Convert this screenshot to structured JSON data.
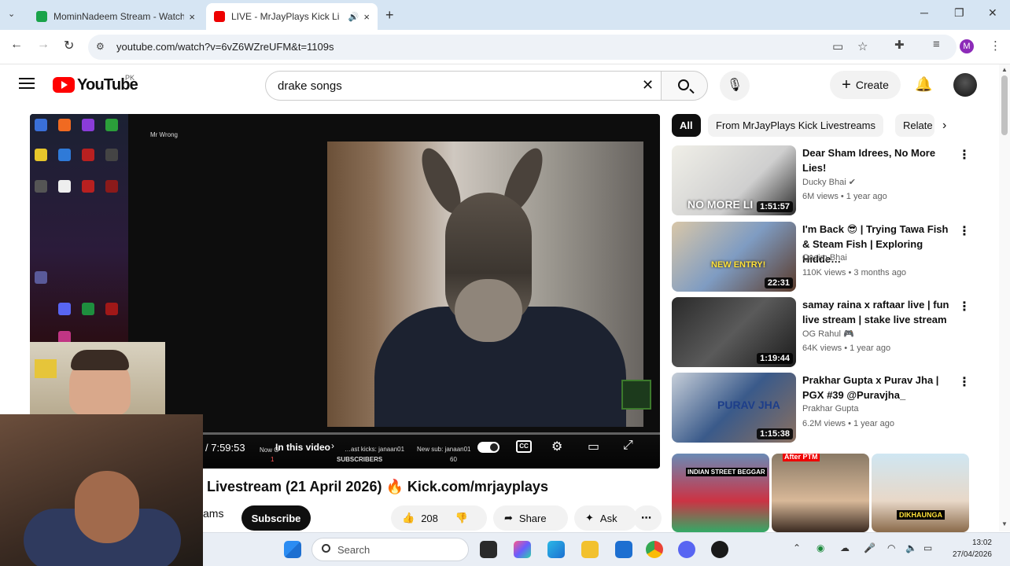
{
  "browser": {
    "tabs": [
      {
        "title": "MominNadeem Stream - Watch",
        "close": "×"
      },
      {
        "title": "LIVE - MrJayPlays Kick Li",
        "close": "×"
      }
    ],
    "new_tab": "+",
    "window_controls": [
      "─",
      "❐",
      "✕"
    ],
    "url": "youtube.com/watch?v=6vZ6WZreUFM&t=1109s",
    "profile_initial": "M"
  },
  "youtube": {
    "logo_text": "YouTube",
    "country_code": "PK",
    "search_value": "drake songs",
    "create_label": "Create"
  },
  "player": {
    "time": "/ 7:59:53",
    "in_this_video": "In this video",
    "progress_fraction": 0.04,
    "stream_overlay": {
      "new_label": "Now G",
      "kicks": "…ast kicks: janaan01",
      "new_sub": "New sub: janaan01",
      "subscribers_label": "SUBSCRIBERS",
      "count_left": "1",
      "count_right": "60",
      "user_name": "Mr Wrong"
    }
  },
  "video": {
    "title": "Livestream (21 April 2026) 🔥 Kick.com/mrjayplays",
    "channel_fragment": "ams",
    "subscribe_label": "Subscribe",
    "likes": "208",
    "share_label": "Share",
    "ask_label": "Ask"
  },
  "chips": [
    {
      "label": "All",
      "active": true
    },
    {
      "label": "From MrJayPlays Kick Livestreams",
      "active": false
    },
    {
      "label": "Relate",
      "active": false
    }
  ],
  "recommendations": [
    {
      "title": "Dear Sham Idrees, No More Lies!",
      "channel": "Ducky Bhai",
      "verified": true,
      "meta": "6M views • 1 year ago",
      "duration": "1:51:57",
      "thumb_text": "NO MORE LI"
    },
    {
      "title": "I'm Back 😎 | Trying Tawa Fish & Steam Fish | Exploring Hidde…",
      "channel": "Qasim Bhai",
      "verified": false,
      "meta": "110K views • 3 months ago",
      "duration": "22:31",
      "thumb_text": "NEW ENTRY!"
    },
    {
      "title": "samay raina x raftaar live | fun live stream | stake live stream",
      "channel": "OG Rahul 🎮",
      "verified": false,
      "meta": "64K views • 1 year ago",
      "duration": "1:19:44",
      "thumb_text": ""
    },
    {
      "title": "Prakhar Gupta x Purav Jha | PGX #39 @Puravjha_",
      "channel": "Prakhar Gupta",
      "verified": false,
      "meta": "6.2M views • 1 year ago",
      "duration": "1:15:38",
      "thumb_text": "PURAV JHA"
    }
  ],
  "shorts": [
    {
      "caption": "INDIAN STREET BEGGAR"
    },
    {
      "caption": "After PTM"
    },
    {
      "caption": "DIKHAUNGA"
    }
  ],
  "taskbar": {
    "search_label": "Search",
    "time": "13:02",
    "date": "27/04/2026"
  }
}
